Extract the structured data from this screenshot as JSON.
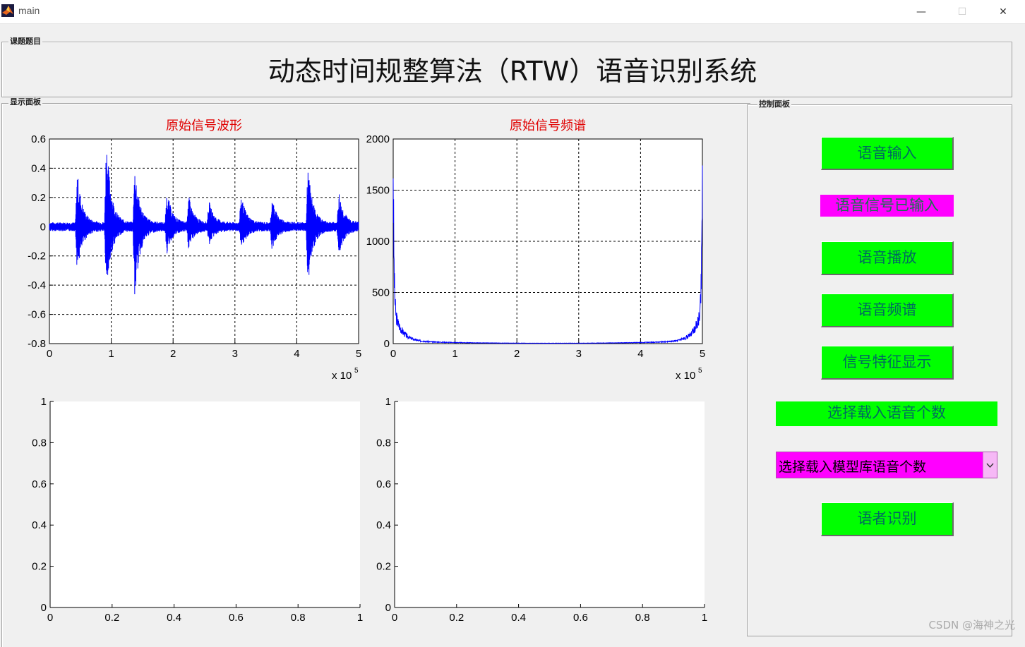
{
  "window": {
    "title": "main",
    "minimize": "—",
    "maximize": "☐",
    "close": "✕"
  },
  "topic_panel": {
    "label": "课题题目",
    "title": "动态时间规整算法（RTW）语音识别系统"
  },
  "display_panel": {
    "label": "显示面板",
    "x_exponent": "x 10",
    "x_exponent_power": "5"
  },
  "control_panel": {
    "label": "控制面板",
    "buttons": {
      "voice_input": "语音输入",
      "voice_play": "语音播放",
      "voice_spectrum": "语音频谱",
      "feature_display": "信号特征显示",
      "speaker_recognition": "语者识别"
    },
    "status_text": "语音信号已输入",
    "select_count_label": "选择载入语音个数",
    "dropdown_value": "选择载入模型库语音个数"
  },
  "watermark": "CSDN @海神之光",
  "colors": {
    "button": "#00ff00",
    "status": "#ff00ff",
    "plot_line": "#0000ff",
    "plot_title": "#e00000"
  },
  "chart_data": [
    {
      "type": "line",
      "title": "原始信号波形",
      "xlim": [
        0,
        500000
      ],
      "ylim": [
        -0.8,
        0.6
      ],
      "x_ticks": [
        "0",
        "1",
        "2",
        "3",
        "4",
        "5"
      ],
      "y_ticks": [
        "0.6",
        "0.4",
        "0.2",
        "0",
        "-0.2",
        "-0.4",
        "-0.6",
        "-0.8"
      ],
      "grid": true,
      "series": [
        {
          "bursts": [
            {
              "x": 0.45,
              "amp_pos": 0.36,
              "amp_neg": 0.3
            },
            {
              "x": 0.92,
              "amp_pos": 0.6,
              "amp_neg": 0.46
            },
            {
              "x": 1.38,
              "amp_pos": 0.4,
              "amp_neg": 0.49
            },
            {
              "x": 1.9,
              "amp_pos": 0.23,
              "amp_neg": 0.16
            },
            {
              "x": 2.25,
              "amp_pos": 0.19,
              "amp_neg": 0.13
            },
            {
              "x": 2.58,
              "amp_pos": 0.15,
              "amp_neg": 0.1
            },
            {
              "x": 3.1,
              "amp_pos": 0.2,
              "amp_neg": 0.15
            },
            {
              "x": 3.6,
              "amp_pos": 0.17,
              "amp_neg": 0.14
            },
            {
              "x": 4.18,
              "amp_pos": 0.4,
              "amp_neg": 0.38
            },
            {
              "x": 4.68,
              "amp_pos": 0.22,
              "amp_neg": 0.18
            }
          ],
          "noise_floor": 0.03
        }
      ]
    },
    {
      "type": "line",
      "title": "原始信号频谱",
      "xlim": [
        0,
        500000
      ],
      "ylim": [
        0,
        2000
      ],
      "x_ticks": [
        "0",
        "1",
        "2",
        "3",
        "4",
        "5"
      ],
      "y_ticks": [
        "2000",
        "1500",
        "1000",
        "500",
        "0"
      ],
      "grid": true,
      "series": [
        {
          "peak_left": 1850,
          "peak_right": 1830
        }
      ]
    },
    {
      "type": "line",
      "xlim": [
        0,
        1
      ],
      "ylim": [
        0,
        1
      ],
      "x_ticks": [
        "0",
        "0.2",
        "0.4",
        "0.6",
        "0.8",
        "1"
      ],
      "y_ticks": [
        "1",
        "0.8",
        "0.6",
        "0.4",
        "0.2",
        "0"
      ],
      "grid": false,
      "series": []
    },
    {
      "type": "line",
      "xlim": [
        0,
        1
      ],
      "ylim": [
        0,
        1
      ],
      "x_ticks": [
        "0",
        "0.2",
        "0.4",
        "0.6",
        "0.8",
        "1"
      ],
      "y_ticks": [
        "1",
        "0.8",
        "0.6",
        "0.4",
        "0.2",
        "0"
      ],
      "grid": false,
      "series": []
    }
  ]
}
